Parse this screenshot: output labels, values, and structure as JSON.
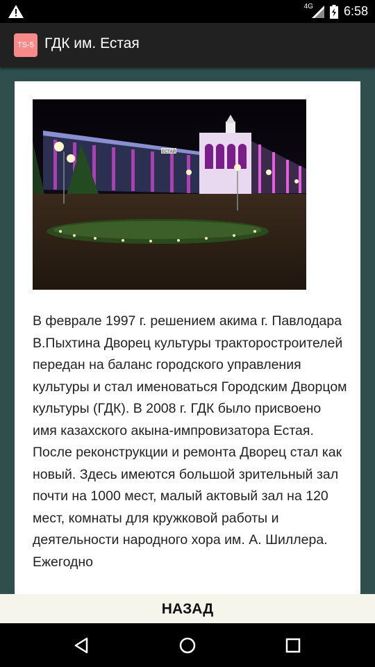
{
  "status_bar": {
    "time": "6:58",
    "network": "4G"
  },
  "app_bar": {
    "icon_text": "TS-5",
    "title": "ГДК им. Естая"
  },
  "content": {
    "photo_sign_text": "ЕСТАЙ",
    "article_text": "В феврале 1997 г. решением акима г. Павлодара В.Пыхтина Дворец культуры тракторостроителей передан на баланс городского управления культуры и стал именоваться Городским Дворцом культуры (ГДК). В 2008 г. ГДК было присвоено имя казахского акына-импровизатора Естая. После реконструкции и ремонта Дворец стал как новый. Здесь имеются большой зрительный зал почти на 1000 мест, малый актовый зал на 120 мест, комнаты для кружковой работы и деятельности народного хора им. А. Шиллера. Ежегодно"
  },
  "back_button": {
    "label": "НАЗАД"
  },
  "icons": {
    "status": [
      "warning-icon",
      "signal-icon",
      "battery-icon"
    ],
    "nav": [
      "back-icon",
      "home-icon",
      "recents-icon"
    ]
  },
  "colors": {
    "background": "#2f4f4f",
    "app_bar": "#212121",
    "app_icon": "#f88a8a",
    "back_bar": "#f5f5ec"
  }
}
